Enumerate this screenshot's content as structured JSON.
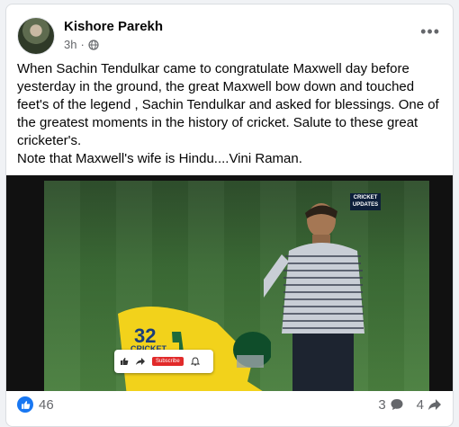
{
  "post": {
    "author": "Kishore Parekh",
    "time": "3h",
    "more_label": "•••",
    "text_lines": [
      "When Sachin Tendulkar came to congratulate Maxwell day before yesterday in the ground, the great Maxwell bow down and touched feet's of the legend , Sachin Tendulkar and asked for blessings. One of the greatest moments in the history of cricket. Salute to these great cricketer's.",
      "Note that Maxwell's wife is Hindu....Vini Raman."
    ]
  },
  "media": {
    "badge_line1": "CRICKET",
    "badge_line2": "UPDATES",
    "jersey_text": "CRICKET",
    "jersey_number": "32",
    "yt_subscribe": "Subscribe"
  },
  "footer": {
    "reaction_count": "46",
    "comment_count": "3",
    "share_count": "4"
  },
  "colors": {
    "accent": "#1877f2",
    "secondary_text": "#65676b",
    "primary_text": "#050505"
  },
  "icons": [
    "globe-icon",
    "more-options-icon",
    "like-reaction-icon",
    "comment-icon",
    "share-icon",
    "youtube-like-icon",
    "youtube-share-icon",
    "bell-icon"
  ]
}
